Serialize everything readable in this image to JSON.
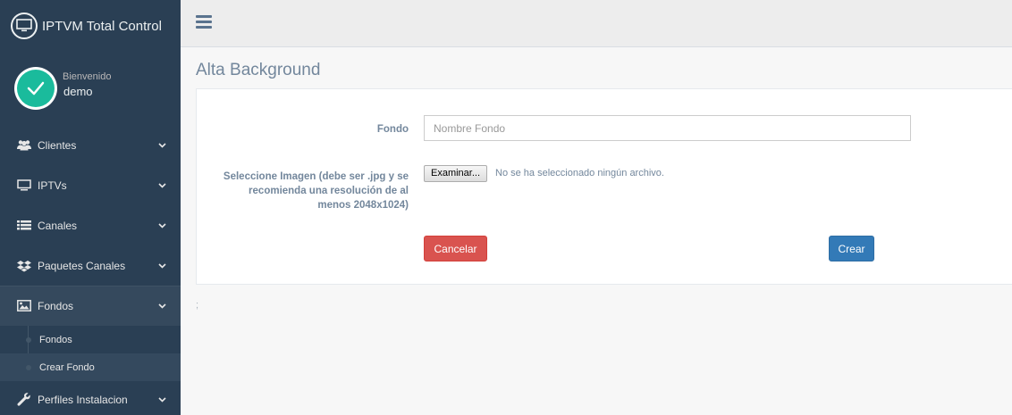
{
  "app": {
    "title": "IPTVM Total Control"
  },
  "profile": {
    "welcome": "Bienvenido",
    "username": "demo"
  },
  "sidebar": {
    "items": [
      {
        "label": "Clientes",
        "icon": "users-icon"
      },
      {
        "label": "IPTVs",
        "icon": "monitor-icon"
      },
      {
        "label": "Canales",
        "icon": "list-icon"
      },
      {
        "label": "Paquetes Canales",
        "icon": "dropbox-icon"
      },
      {
        "label": "Fondos",
        "icon": "image-icon"
      },
      {
        "label": "Perfiles Instalacion",
        "icon": "wrench-icon"
      }
    ],
    "submenu": [
      {
        "label": "Fondos"
      },
      {
        "label": "Crear Fondo"
      }
    ]
  },
  "page": {
    "title": "Alta Background"
  },
  "form": {
    "fondo_label": "Fondo",
    "fondo_placeholder": "Nombre Fondo",
    "fondo_value": "",
    "image_label_line1": "Seleccione Imagen (debe ser .jpg y se",
    "image_label_line2": "recomienda una resolución de al",
    "image_label_line3": "menos 2048x1024)",
    "file_button": "Examinar...",
    "file_status": "No se ha seleccionado ningún archivo.",
    "cancel_label": "Cancelar",
    "create_label": "Crear"
  },
  "footer": {
    "mark": ";"
  },
  "colors": {
    "sidebar": "#2a3f54",
    "accent": "#1abb9c",
    "danger": "#d9534f",
    "primary": "#337ab7"
  }
}
